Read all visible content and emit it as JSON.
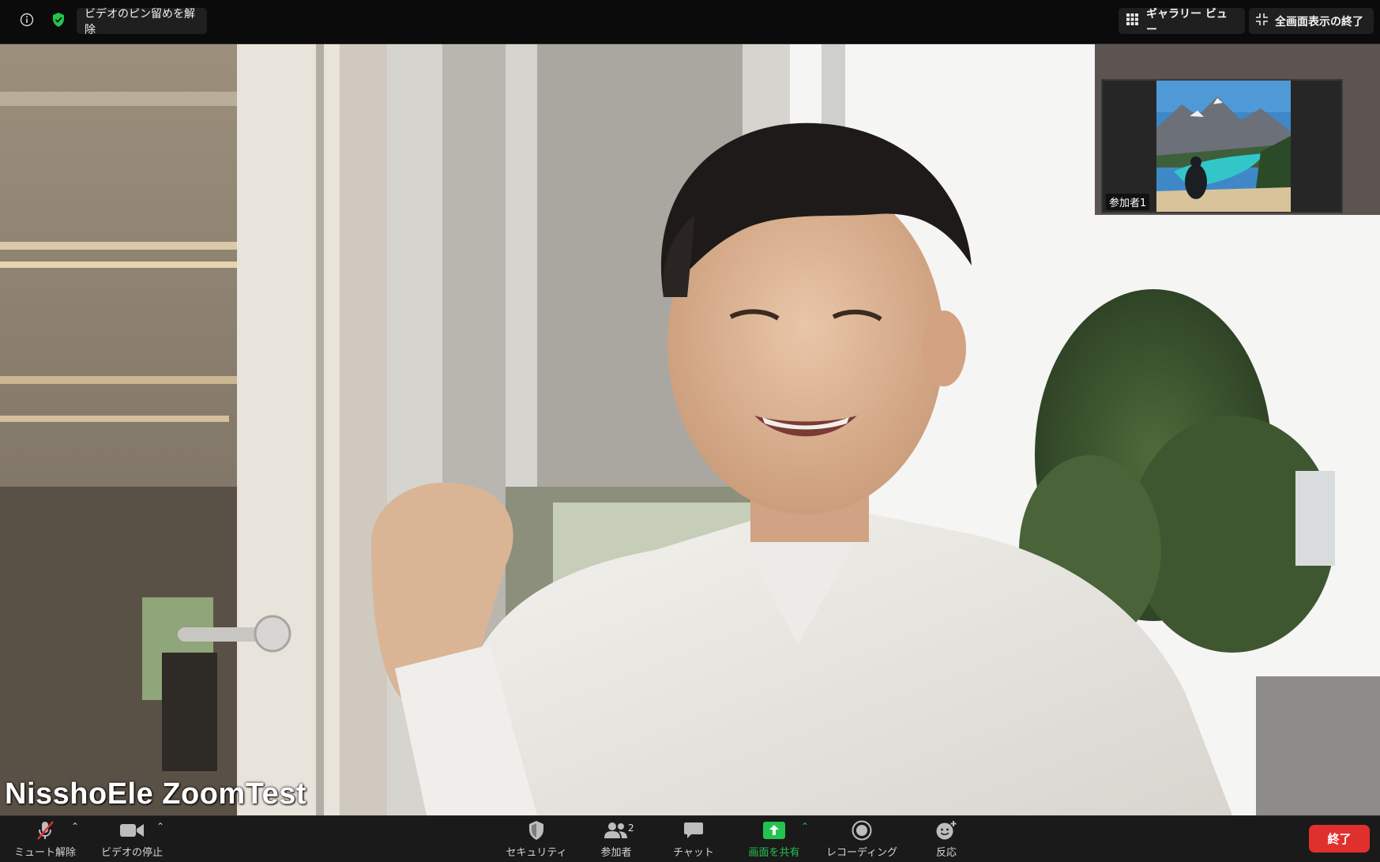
{
  "top_bar": {
    "unpin_label": "ビデオのピン留めを解除",
    "gallery_label": "ギャラリー ビュー",
    "exit_fullscreen_label": "全画面表示の終了",
    "info_icon": "info-icon",
    "security_shield_icon": "green-shield-icon"
  },
  "main_video": {
    "speaker_name": "NisshoEle ZoomTest"
  },
  "thumbnail": {
    "participant_label": "参加者1"
  },
  "toolbar": {
    "unmute_label": "ミュート解除",
    "stop_video_label": "ビデオの停止",
    "security_label": "セキュリティ",
    "participants_label": "参加者",
    "participants_count": "2",
    "chat_label": "チャット",
    "share_screen_label": "画面を共有",
    "recording_label": "レコーディング",
    "reactions_label": "反応",
    "end_label": "終了"
  },
  "colors": {
    "share_green": "#23c34f",
    "end_red": "#e0302e",
    "toolbar_bg": "#1a1a1a"
  }
}
